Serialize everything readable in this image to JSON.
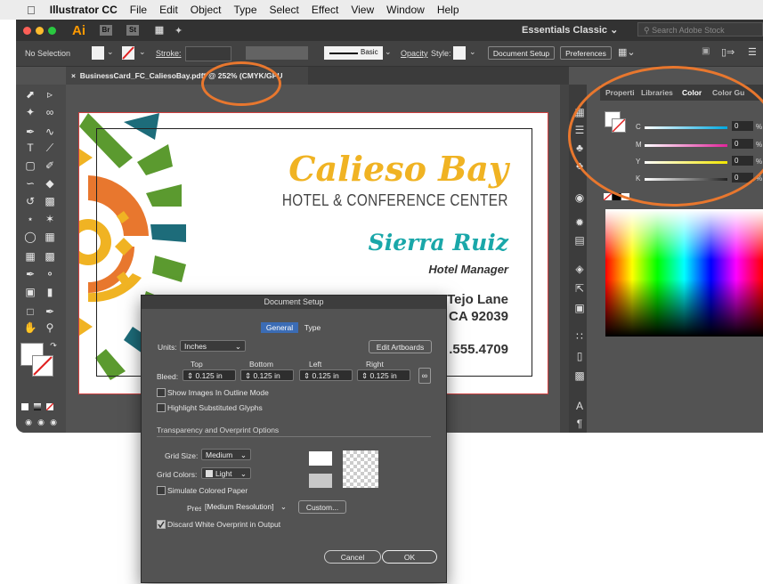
{
  "menubar": {
    "apple": "",
    "app_name": "Illustrator CC",
    "items": [
      "File",
      "Edit",
      "Object",
      "Type",
      "Select",
      "Effect",
      "View",
      "Window",
      "Help"
    ]
  },
  "titlebar": {
    "ai_logo": "Ai",
    "bridge": "Br",
    "stock": "St",
    "workspace": "Essentials Classic",
    "search_placeholder": "Search Adobe Stock"
  },
  "controlbar": {
    "selection": "No Selection",
    "stroke_label": "Stroke:",
    "basic": "Basic",
    "opacity_label": "Opacity",
    "style_label": "Style:",
    "document_setup": "Document Setup",
    "preferences": "Preferences"
  },
  "document_tab": {
    "close": "×",
    "title": "BusinessCard_FC_CaliesoBay.pdf* @ 252% (CMYK/GPU Preview)"
  },
  "business_card": {
    "brand": "Calieso Bay",
    "tagline": "HOTEL & CONFERENCE CENTER",
    "name": "Sierra Ruiz",
    "role": "Hotel Manager",
    "address1": "Tejo Lane",
    "address2": "CA 92039",
    "phone": ".555.4709"
  },
  "color_panel": {
    "tabs": [
      "Properti",
      "Libraries",
      "Color",
      "Color Gu"
    ],
    "active_tab": "Color",
    "sliders": [
      {
        "label": "C",
        "value": "0",
        "unit": "%",
        "color": "#00a8e0"
      },
      {
        "label": "M",
        "value": "0",
        "unit": "%",
        "color": "#e0249a"
      },
      {
        "label": "Y",
        "value": "0",
        "unit": "%",
        "color": "#f2e600"
      },
      {
        "label": "K",
        "value": "0",
        "unit": "%",
        "color": "#222222"
      }
    ]
  },
  "dialog": {
    "title": "Document Setup",
    "tabs": [
      "General",
      "Type"
    ],
    "units_label": "Units:",
    "units_value": "Inches",
    "edit_artboards": "Edit Artboards",
    "bleed_label": "Bleed:",
    "bleed_headers": [
      "Top",
      "Bottom",
      "Left",
      "Right"
    ],
    "bleed_values": [
      "0.125 in",
      "0.125 in",
      "0.125 in",
      "0.125 in"
    ],
    "show_images_outline": "Show Images In Outline Mode",
    "highlight_glyphs": "Highlight Substituted Glyphs",
    "transparency_section": "Transparency and Overprint Options",
    "grid_size_label": "Grid Size:",
    "grid_size_value": "Medium",
    "grid_colors_label": "Grid Colors:",
    "grid_colors_value": "Light",
    "simulate_paper": "Simulate Colored Paper",
    "preset_label": "Preset:",
    "preset_value": "[Medium Resolution]",
    "custom_button": "Custom...",
    "discard_white": "Discard White Overprint in Output",
    "cancel": "Cancel",
    "ok": "OK"
  },
  "colors": {
    "accent_orange": "#e8772e",
    "brand_gold": "#f0b323",
    "brand_teal": "#1aa7a9",
    "brand_green": "#5b9a2f",
    "brand_darkteal": "#1d6c7a"
  }
}
